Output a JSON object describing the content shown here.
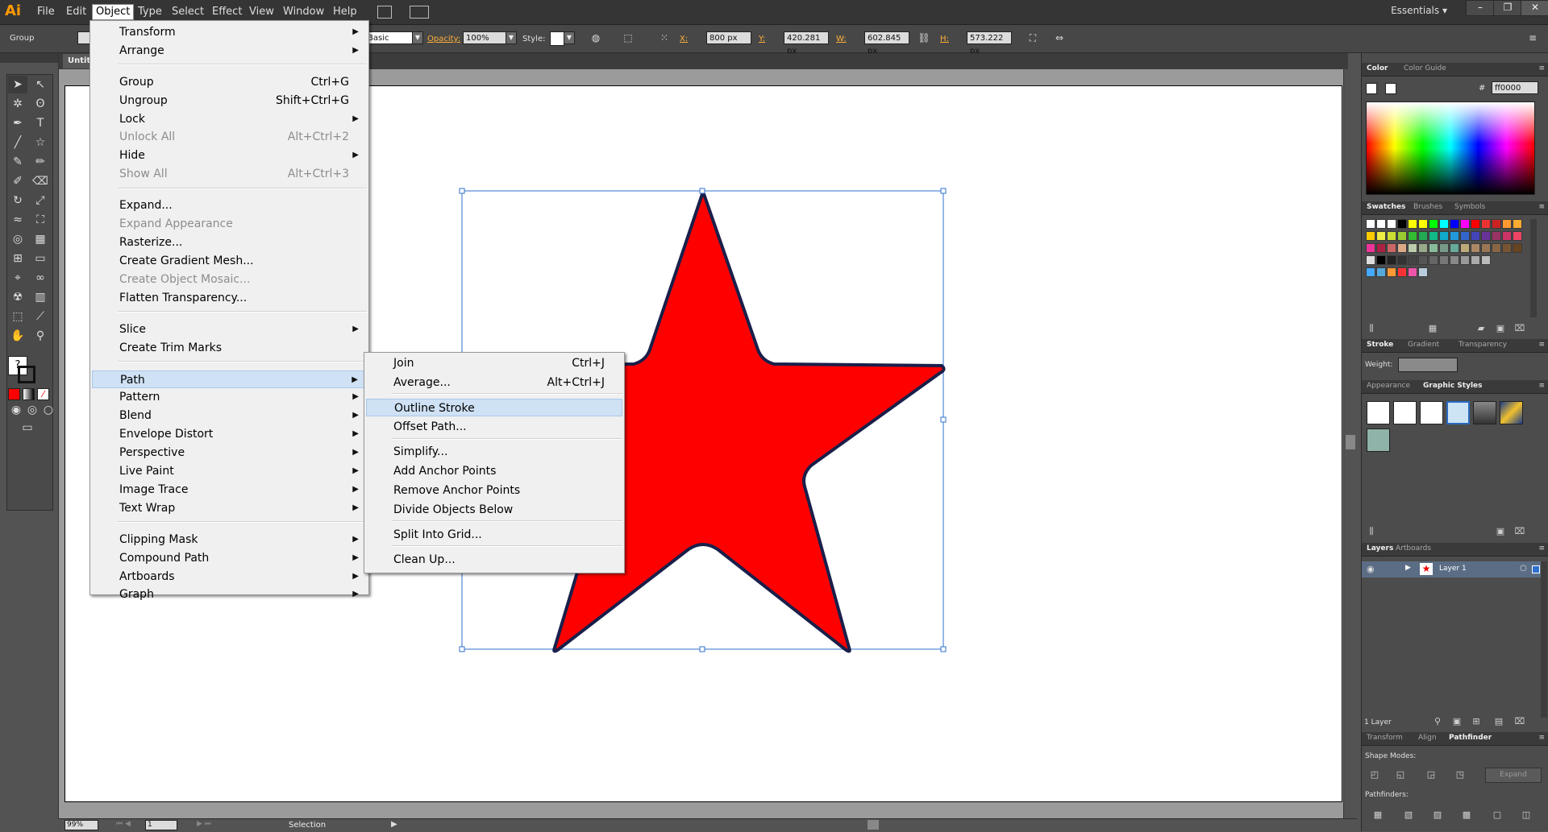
{
  "app": {
    "logo": "Ai",
    "menus": [
      "File",
      "Edit",
      "Object",
      "Type",
      "Select",
      "Effect",
      "View",
      "Window",
      "Help"
    ],
    "active_menu": "Object",
    "workspace": "Essentials",
    "window_buttons": [
      "–",
      "❐",
      "✕"
    ]
  },
  "control_bar": {
    "selection_label": "Group",
    "stroke_style": "Basic",
    "opacity_label": "Opacity:",
    "opacity_value": "100%",
    "style_label": "Style:",
    "x_label": "X:",
    "x_value": "800 px",
    "y_label": "Y:",
    "y_value": "420.281 px",
    "w_label": "W:",
    "w_value": "602.845 px",
    "h_label": "H:",
    "h_value": "573.222 px"
  },
  "document": {
    "tab_title": "Untitl"
  },
  "object_menu": {
    "items": [
      {
        "label": "Transform",
        "shortcut": "",
        "submenu": true,
        "disabled": false
      },
      {
        "label": "Arrange",
        "shortcut": "",
        "submenu": true,
        "disabled": false
      },
      {
        "label": "Group",
        "shortcut": "Ctrl+G",
        "submenu": false,
        "disabled": false
      },
      {
        "label": "Ungroup",
        "shortcut": "Shift+Ctrl+G",
        "submenu": false,
        "disabled": false
      },
      {
        "label": "Lock",
        "shortcut": "",
        "submenu": true,
        "disabled": false
      },
      {
        "label": "Unlock All",
        "shortcut": "Alt+Ctrl+2",
        "submenu": false,
        "disabled": true
      },
      {
        "label": "Hide",
        "shortcut": "",
        "submenu": true,
        "disabled": false
      },
      {
        "label": "Show All",
        "shortcut": "Alt+Ctrl+3",
        "submenu": false,
        "disabled": true
      },
      {
        "label": "Expand...",
        "shortcut": "",
        "submenu": false,
        "disabled": false
      },
      {
        "label": "Expand Appearance",
        "shortcut": "",
        "submenu": false,
        "disabled": true
      },
      {
        "label": "Rasterize...",
        "shortcut": "",
        "submenu": false,
        "disabled": false
      },
      {
        "label": "Create Gradient Mesh...",
        "shortcut": "",
        "submenu": false,
        "disabled": false
      },
      {
        "label": "Create Object Mosaic...",
        "shortcut": "",
        "submenu": false,
        "disabled": true
      },
      {
        "label": "Flatten Transparency...",
        "shortcut": "",
        "submenu": false,
        "disabled": false
      },
      {
        "label": "Slice",
        "shortcut": "",
        "submenu": true,
        "disabled": false
      },
      {
        "label": "Create Trim Marks",
        "shortcut": "",
        "submenu": false,
        "disabled": false
      },
      {
        "label": "Path",
        "shortcut": "",
        "submenu": true,
        "disabled": false,
        "highlighted": true
      },
      {
        "label": "Pattern",
        "shortcut": "",
        "submenu": true,
        "disabled": false
      },
      {
        "label": "Blend",
        "shortcut": "",
        "submenu": true,
        "disabled": false
      },
      {
        "label": "Envelope Distort",
        "shortcut": "",
        "submenu": true,
        "disabled": false
      },
      {
        "label": "Perspective",
        "shortcut": "",
        "submenu": true,
        "disabled": false
      },
      {
        "label": "Live Paint",
        "shortcut": "",
        "submenu": true,
        "disabled": false
      },
      {
        "label": "Image Trace",
        "shortcut": "",
        "submenu": true,
        "disabled": false
      },
      {
        "label": "Text Wrap",
        "shortcut": "",
        "submenu": true,
        "disabled": false
      },
      {
        "label": "Clipping Mask",
        "shortcut": "",
        "submenu": true,
        "disabled": false
      },
      {
        "label": "Compound Path",
        "shortcut": "",
        "submenu": true,
        "disabled": false
      },
      {
        "label": "Artboards",
        "shortcut": "",
        "submenu": true,
        "disabled": false
      },
      {
        "label": "Graph",
        "shortcut": "",
        "submenu": true,
        "disabled": false
      }
    ]
  },
  "path_submenu": {
    "items": [
      {
        "label": "Join",
        "shortcut": "Ctrl+J"
      },
      {
        "label": "Average...",
        "shortcut": "Alt+Ctrl+J"
      },
      {
        "label": "Outline Stroke",
        "shortcut": "",
        "highlighted": true
      },
      {
        "label": "Offset Path...",
        "shortcut": ""
      },
      {
        "label": "Simplify...",
        "shortcut": ""
      },
      {
        "label": "Add Anchor Points",
        "shortcut": ""
      },
      {
        "label": "Remove Anchor Points",
        "shortcut": ""
      },
      {
        "label": "Divide Objects Below",
        "shortcut": ""
      },
      {
        "label": "Split Into Grid...",
        "shortcut": ""
      },
      {
        "label": "Clean Up...",
        "shortcut": ""
      }
    ]
  },
  "panels": {
    "color": {
      "tabs": [
        "Color",
        "Color Guide"
      ],
      "hex": "ff0000"
    },
    "swatches": {
      "tabs": [
        "Swatches",
        "Brushes",
        "Symbols"
      ]
    },
    "stroke": {
      "tabs": [
        "Stroke",
        "Gradient",
        "Transparency"
      ],
      "weight_label": "Weight:"
    },
    "appearance": {
      "tabs": [
        "Appearance",
        "Graphic Styles"
      ]
    },
    "layers": {
      "tabs": [
        "Layers",
        "Artboards"
      ],
      "layer_name": "Layer 1",
      "count": "1 Layer"
    },
    "pathfinder": {
      "tabs": [
        "Transform",
        "Align",
        "Pathfinder"
      ],
      "shape_modes": "Shape Modes:",
      "pathfinders": "Pathfinders:",
      "expand": "Expand"
    }
  },
  "status": {
    "zoom": "99%",
    "page": "1",
    "tool": "Selection"
  },
  "colors": {
    "fill": "#ff0000",
    "selection": "#2f6fcf",
    "menu_highlight": "#cfe1f4"
  }
}
